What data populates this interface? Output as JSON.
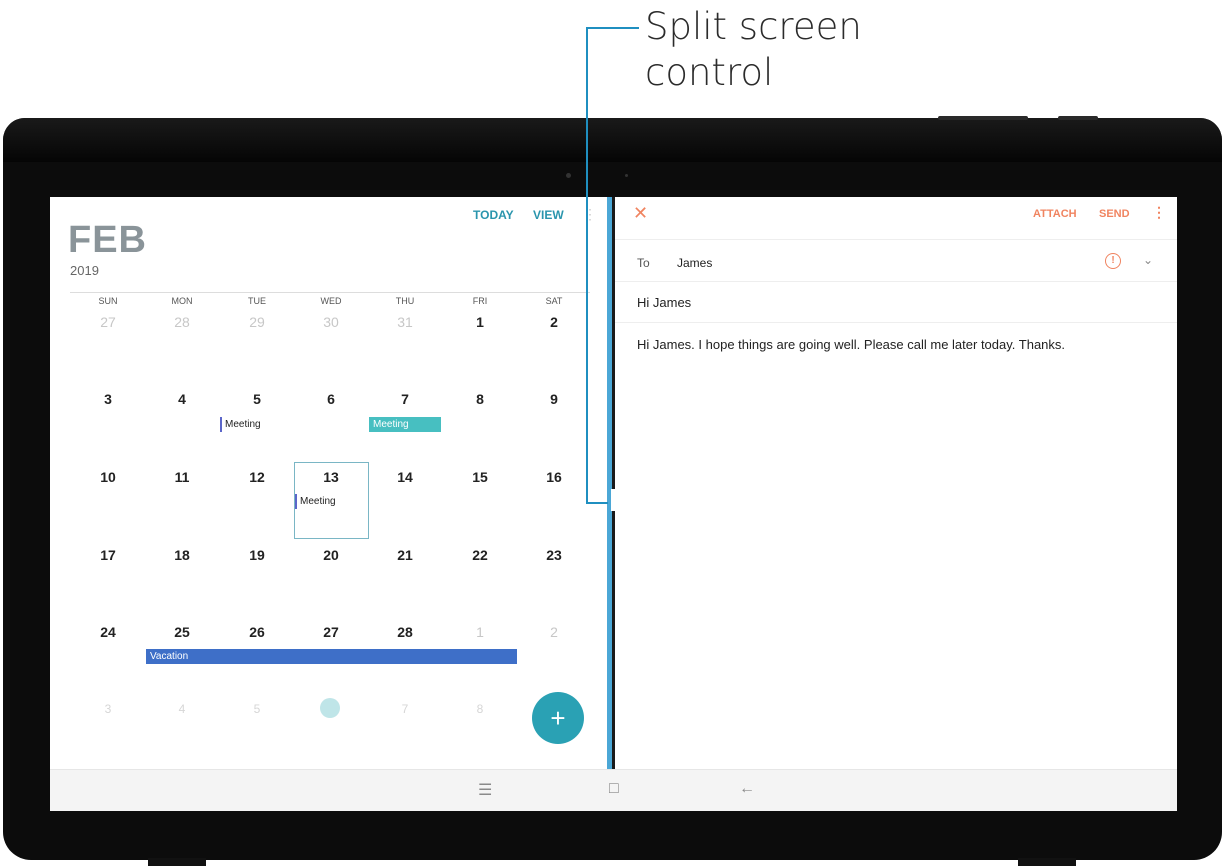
{
  "callout": {
    "label_line1": "Split screen",
    "label_line2": "control",
    "color": "#1f8fc0"
  },
  "calendar": {
    "month": "FEB",
    "year": "2019",
    "actions": {
      "today": "TODAY",
      "view": "VIEW"
    },
    "weekdays": [
      "SUN",
      "MON",
      "TUE",
      "WED",
      "THU",
      "FRI",
      "SAT"
    ],
    "weeks": [
      [
        "27",
        "28",
        "29",
        "30",
        "31",
        "1",
        "2"
      ],
      [
        "3",
        "4",
        "5",
        "6",
        "7",
        "8",
        "9"
      ],
      [
        "10",
        "11",
        "12",
        "13",
        "14",
        "15",
        "16"
      ],
      [
        "17",
        "18",
        "19",
        "20",
        "21",
        "22",
        "23"
      ],
      [
        "24",
        "25",
        "26",
        "27",
        "28",
        "1",
        "2"
      ],
      [
        "3",
        "4",
        "5",
        "6",
        "7",
        "8",
        ""
      ]
    ],
    "events": {
      "meeting_tue": "Meeting",
      "meeting_thu": "Meeting",
      "meeting_wed13": "Meeting",
      "vacation": "Vacation"
    },
    "fab_icon": "add-icon",
    "accent": "#2a95ad"
  },
  "email": {
    "actions": {
      "attach": "ATTACH",
      "send": "SEND"
    },
    "to_label": "To",
    "to_value": "James",
    "subject": "Hi James",
    "body": "Hi James. I hope things are going well. Please call me later today. Thanks.",
    "accent": "#f08460"
  },
  "navbar": {
    "icons": [
      "recent-apps-icon",
      "home-icon",
      "back-icon"
    ]
  }
}
